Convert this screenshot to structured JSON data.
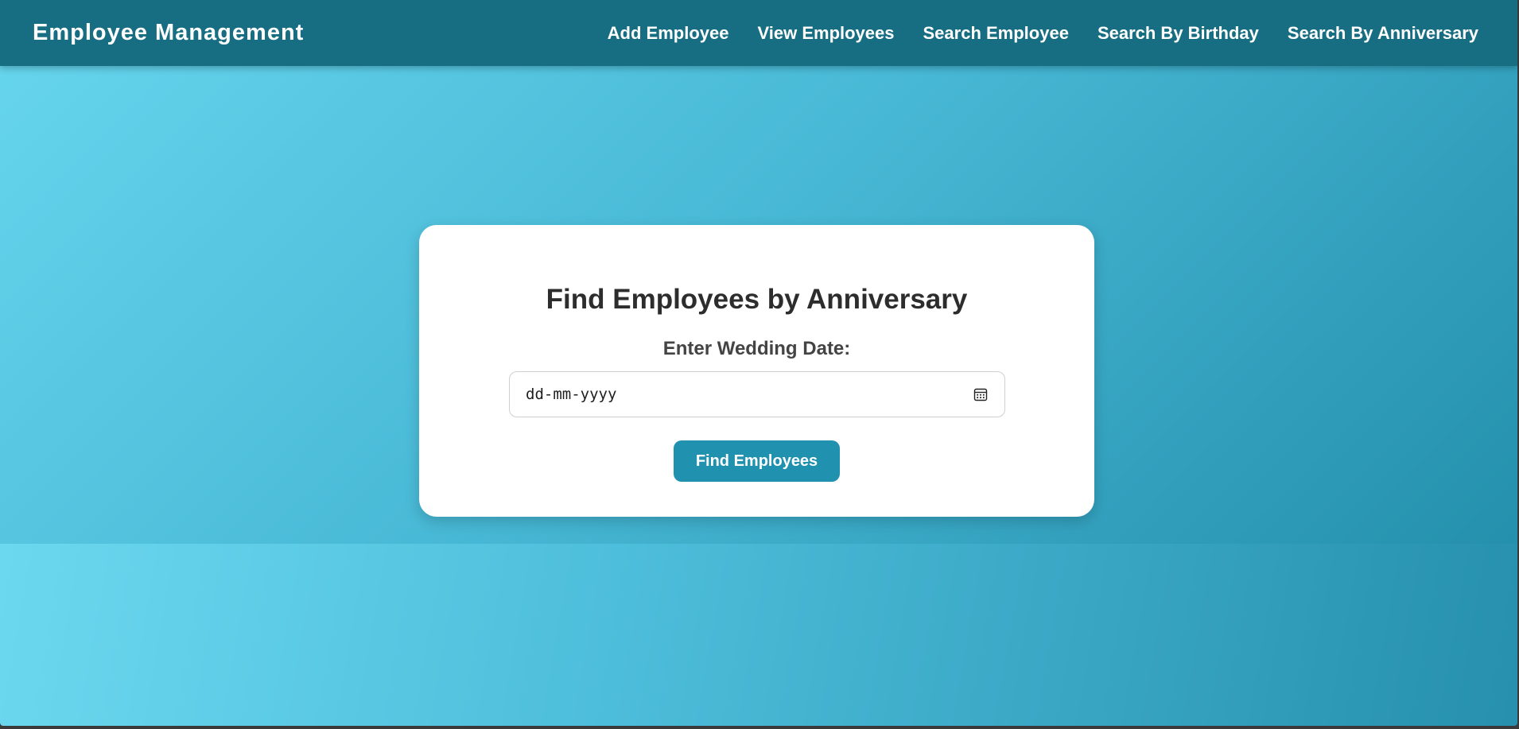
{
  "navbar": {
    "brand": "Employee Management",
    "links": [
      {
        "label": "Add Employee"
      },
      {
        "label": "View Employees"
      },
      {
        "label": "Search Employee"
      },
      {
        "label": "Search By Birthday"
      },
      {
        "label": "Search By Anniversary"
      }
    ]
  },
  "form": {
    "title": "Find Employees by Anniversary",
    "date_label": "Enter Wedding Date:",
    "date_placeholder": "dd-mm-yyyy",
    "calendar_icon": "calendar-icon",
    "submit_label": "Find Employees"
  },
  "colors": {
    "navbar_bg": "#176e82",
    "button_bg": "#2191b0",
    "gradient_start": "#65d4ec",
    "gradient_end": "#2490ad"
  }
}
